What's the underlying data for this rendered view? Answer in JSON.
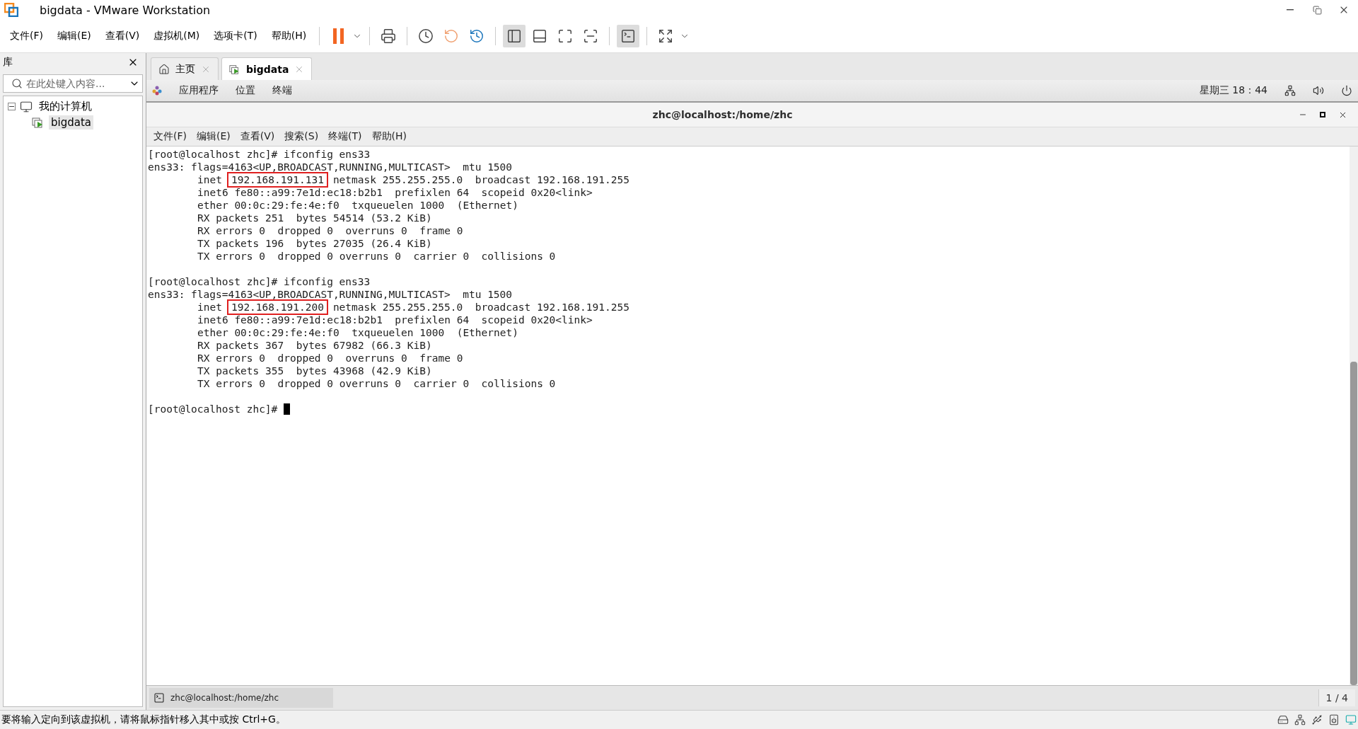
{
  "window": {
    "title": "bigdata - VMware Workstation"
  },
  "menu": [
    {
      "label": "文件(F)"
    },
    {
      "label": "编辑(E)"
    },
    {
      "label": "查看(V)"
    },
    {
      "label": "虚拟机(M)"
    },
    {
      "label": "选项卡(T)"
    },
    {
      "label": "帮助(H)"
    }
  ],
  "library": {
    "title": "库",
    "search": {
      "placeholder": "在此处键入内容..."
    },
    "tree": [
      {
        "label": "我的计算机",
        "expanded": true,
        "selected": false,
        "children": [
          {
            "label": "bigdata",
            "selected": true
          }
        ]
      }
    ]
  },
  "tabs": [
    {
      "label": "主页",
      "selected": false
    },
    {
      "label": "bigdata",
      "selected": true
    }
  ],
  "guest_bar": {
    "menu": [
      "应用程序",
      "位置",
      "终端"
    ],
    "clock": "星期三 18：44"
  },
  "terminal": {
    "title": "zhc@localhost:/home/zhc",
    "menu": [
      "文件(F)",
      "编辑(E)",
      "查看(V)",
      "搜索(S)",
      "终端(T)",
      "帮助(H)"
    ],
    "lines": [
      {
        "kind": "plain",
        "parts": [
          {
            "text": "[root@localhost zhc]# ifconfig ens33",
            "boxed": false
          }
        ]
      },
      {
        "kind": "plain",
        "parts": [
          {
            "text": "ens33: flags=4163<UP,BROADCAST,RUNNING,MULTICAST>  mtu 1500",
            "boxed": false
          }
        ]
      },
      {
        "kind": "indented",
        "parts": [
          {
            "text": "inet",
            "boxed": false
          },
          {
            "text": "192.168.191.131",
            "boxed": true
          },
          {
            "text": "netmask 255.255.255.0  broadcast 192.168.191.255",
            "boxed": false
          }
        ]
      },
      {
        "kind": "indented",
        "parts": [
          {
            "text": "inet6 fe80::a99:7e1d:ec18:b2b1  prefixlen 64  scopeid 0x20<link>",
            "boxed": false
          }
        ]
      },
      {
        "kind": "indented",
        "parts": [
          {
            "text": "ether 00:0c:29:fe:4e:f0  txqueuelen 1000  (Ethernet)",
            "boxed": false
          }
        ]
      },
      {
        "kind": "indented",
        "parts": [
          {
            "text": "RX packets 251  bytes 54514 (53.2 KiB)",
            "boxed": false
          }
        ]
      },
      {
        "kind": "indented",
        "parts": [
          {
            "text": "RX errors 0  dropped 0  overruns 0  frame 0",
            "boxed": false
          }
        ]
      },
      {
        "kind": "indented",
        "parts": [
          {
            "text": "TX packets 196  bytes 27035 (26.4 KiB)",
            "boxed": false
          }
        ]
      },
      {
        "kind": "indented",
        "parts": [
          {
            "text": "TX errors 0  dropped 0 overruns 0  carrier 0  collisions 0",
            "boxed": false
          }
        ]
      },
      {
        "kind": "blank"
      },
      {
        "kind": "plain",
        "parts": [
          {
            "text": "[root@localhost zhc]# ifconfig ens33",
            "boxed": false
          }
        ]
      },
      {
        "kind": "plain",
        "parts": [
          {
            "text": "ens33: flags=4163<UP,BROADCAST,RUNNING,MULTICAST>  mtu 1500",
            "boxed": false
          }
        ]
      },
      {
        "kind": "indented",
        "parts": [
          {
            "text": "inet",
            "boxed": false
          },
          {
            "text": "192.168.191.200",
            "boxed": true
          },
          {
            "text": "netmask 255.255.255.0  broadcast 192.168.191.255",
            "boxed": false
          }
        ]
      },
      {
        "kind": "indented",
        "parts": [
          {
            "text": "inet6 fe80::a99:7e1d:ec18:b2b1  prefixlen 64  scopeid 0x20<link>",
            "boxed": false
          }
        ]
      },
      {
        "kind": "indented",
        "parts": [
          {
            "text": "ether 00:0c:29:fe:4e:f0  txqueuelen 1000  (Ethernet)",
            "boxed": false
          }
        ]
      },
      {
        "kind": "indented",
        "parts": [
          {
            "text": "RX packets 367  bytes 67982 (66.3 KiB)",
            "boxed": false
          }
        ]
      },
      {
        "kind": "indented",
        "parts": [
          {
            "text": "RX errors 0  dropped 0  overruns 0  frame 0",
            "boxed": false
          }
        ]
      },
      {
        "kind": "indented",
        "parts": [
          {
            "text": "TX packets 355  bytes 43968 (42.9 KiB)",
            "boxed": false
          }
        ]
      },
      {
        "kind": "indented",
        "parts": [
          {
            "text": "TX errors 0  dropped 0 overruns 0  carrier 0  collisions 0",
            "boxed": false
          }
        ]
      },
      {
        "kind": "blank"
      },
      {
        "kind": "prompt",
        "parts": [
          {
            "text": "[root@localhost zhc]#",
            "boxed": false
          }
        ]
      }
    ]
  },
  "taskbar": {
    "item": "zhc@localhost:/home/zhc",
    "pager": "1 / 4"
  },
  "status_bar": {
    "message": "要将输入定向到该虚拟机，请将鼠标指针移入其中或按 Ctrl+G。"
  }
}
